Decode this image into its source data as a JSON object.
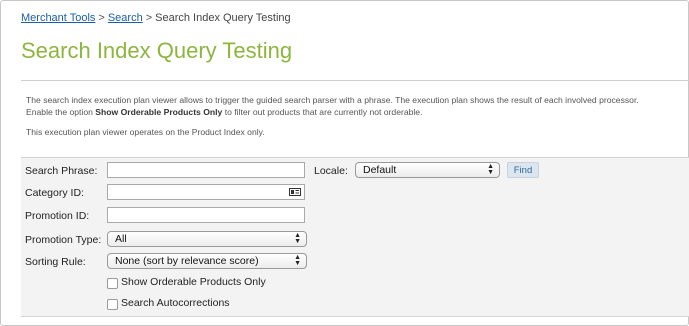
{
  "breadcrumb": {
    "items": [
      "Merchant Tools",
      "Search"
    ],
    "current": "Search Index Query Testing",
    "separator": ">"
  },
  "page": {
    "title": "Search Index Query Testing",
    "title_color": "#8cb63e",
    "description_line1": "The search index execution plan viewer allows to trigger the guided search parser with a phrase. The execution plan shows the result of each involved processor.",
    "description_line2_pre": "Enable the option ",
    "description_line2_bold": "Show Orderable Products Only",
    "description_line2_post": " to filter out products that are currently not orderable.",
    "description_line3": "This execution plan viewer operates on the Product Index only."
  },
  "form": {
    "search_phrase_label": "Search Phrase:",
    "search_phrase_value": "",
    "locale_label": "Locale:",
    "locale_value": "Default",
    "find_label": "Find",
    "category_id_label": "Category ID:",
    "category_id_value": "",
    "category_picker_icon": "calendar-card-icon",
    "promotion_id_label": "Promotion ID:",
    "promotion_id_value": "",
    "promotion_type_label": "Promotion Type:",
    "promotion_type_value": "All",
    "sorting_rule_label": "Sorting Rule:",
    "sorting_rule_value": "None (sort by relevance score)",
    "show_orderable_label": "Show Orderable Products Only",
    "show_orderable_checked": false,
    "search_autocorrections_label": "Search Autocorrections",
    "search_autocorrections_checked": false
  }
}
